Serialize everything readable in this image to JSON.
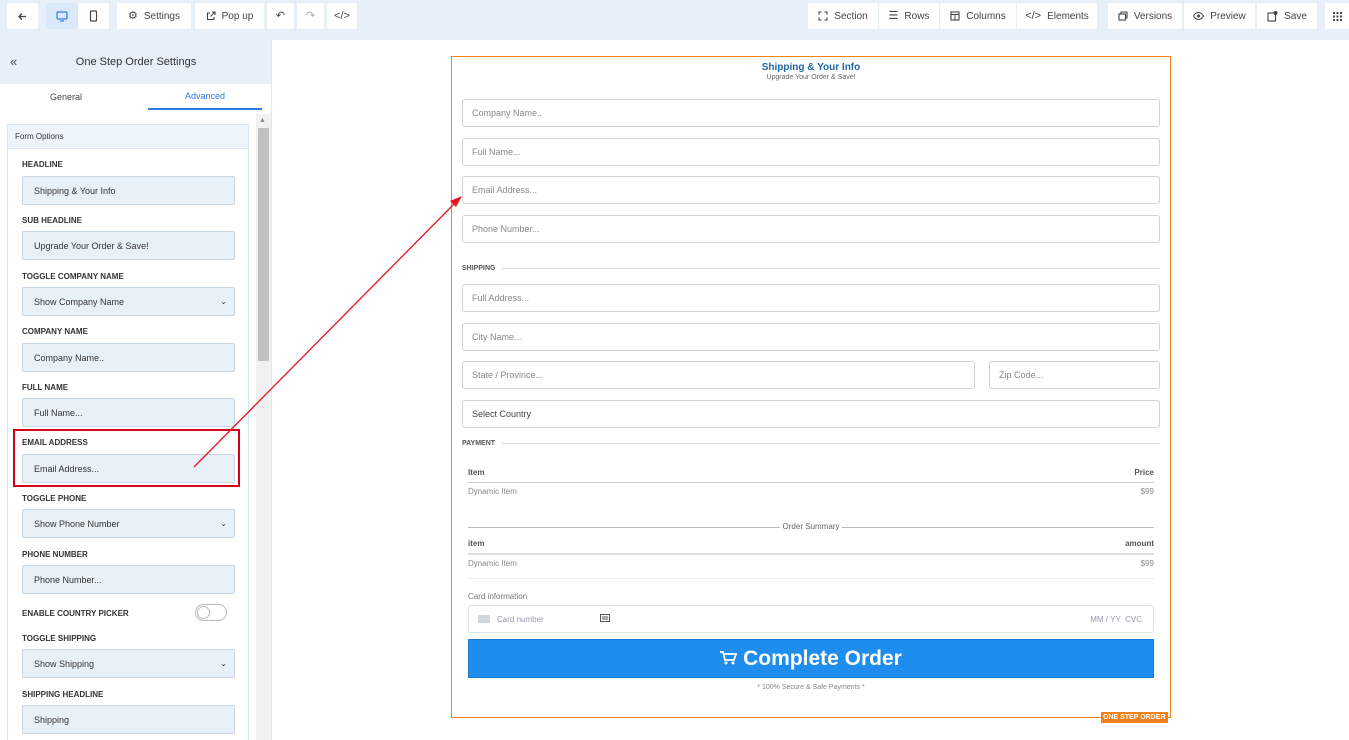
{
  "toolbar": {
    "settings": "Settings",
    "popup": "Pop up",
    "section": "Section",
    "rows": "Rows",
    "columns": "Columns",
    "elements": "Elements",
    "versions": "Versions",
    "preview": "Preview",
    "save": "Save"
  },
  "sidebar": {
    "title": "One Step Order Settings",
    "tabs": [
      "General",
      "Advanced"
    ],
    "active_tab": "Advanced",
    "panel_title": "Form Options",
    "fields": [
      {
        "label": "HEADLINE",
        "value": "Shipping & Your Info"
      },
      {
        "label": "SUB HEADLINE",
        "value": "Upgrade Your Order & Save!"
      },
      {
        "label": "TOGGLE COMPANY NAME",
        "value": "Show Company Name"
      },
      {
        "label": "COMPANY NAME",
        "value": "Company Name.."
      },
      {
        "label": "FULL NAME",
        "value": "Full Name..."
      },
      {
        "label": "EMAIL ADDRESS",
        "value": "Email Address..."
      },
      {
        "label": "TOGGLE PHONE",
        "value": "Show Phone Number"
      },
      {
        "label": "PHONE NUMBER",
        "value": "Phone Number..."
      },
      {
        "label": "ENABLE COUNTRY PICKER",
        "value": false
      },
      {
        "label": "TOGGLE SHIPPING",
        "value": "Show Shipping"
      },
      {
        "label": "SHIPPING HEADLINE",
        "value": "Shipping"
      }
    ]
  },
  "form": {
    "headline": "Shipping & Your Info",
    "subheadline": "Upgrade Your Order & Save!",
    "company_placeholder": "Company Name..",
    "fullname_placeholder": "Full Name...",
    "email_placeholder": "Email Address...",
    "phone_placeholder": "Phone Number...",
    "shipping_label": "SHIPPING",
    "address_placeholder": "Full Address...",
    "city_placeholder": "City Name...",
    "state_placeholder": "State / Province...",
    "zip_placeholder": "Zip Code...",
    "country_placeholder": "Select Country",
    "payment_label": "PAYMENT",
    "items_header": {
      "item": "Item",
      "price": "Price"
    },
    "items": [
      {
        "name": "Dynamic Item",
        "price": "$99"
      }
    ],
    "summary_label": "Order Summary",
    "summary_header": {
      "item": "item",
      "amount": "amount"
    },
    "summary_items": [
      {
        "name": "Dynamic Item",
        "amount": "$99"
      }
    ],
    "card_info_label": "Card information",
    "card_number_placeholder": "Card number",
    "card_expiry_cvc": "MM / YY  CVC",
    "submit_label": "Complete Order",
    "secure_note": "* 100% Secure & Safe Payments *",
    "badge": "ONE STEP ORDER"
  },
  "colors": {
    "accent": "#2c7be5",
    "button": "#1f8ded",
    "form_border": "#f0821e",
    "highlight": "#d0021b",
    "title_blue": "#1f66a6"
  },
  "icons": [
    "back-arrow-icon",
    "desktop-icon",
    "mobile-icon",
    "gears-icon",
    "external-link-icon",
    "undo-icon",
    "redo-icon",
    "code-icon",
    "expand-icon",
    "rows-icon",
    "columns-icon",
    "elements-code-icon",
    "versions-icon",
    "eye-icon",
    "save-icon",
    "grid-icon",
    "double-chevron-left-icon",
    "cart-icon",
    "card-icon"
  ]
}
